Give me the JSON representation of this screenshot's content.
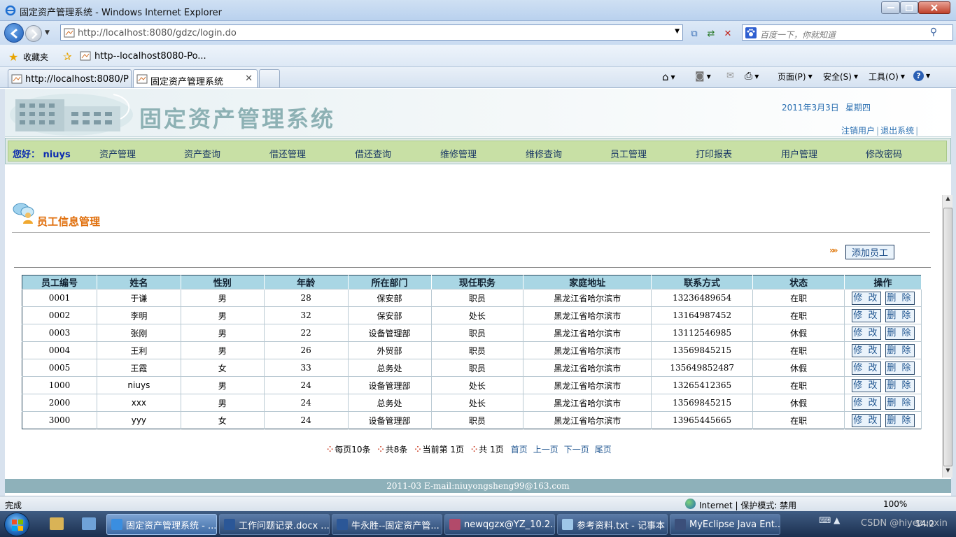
{
  "window": {
    "title": "固定资产管理系统 - Windows Internet Explorer"
  },
  "address": {
    "url": "http://localhost:8080/gdzc/login.do",
    "search_placeholder": "百度一下，你就知道"
  },
  "favorites": {
    "label": "收藏夹",
    "link": "http--localhost8080-Po..."
  },
  "tabs": [
    {
      "label": "http://localhost:8080/Po..."
    },
    {
      "label": "固定资产管理系统"
    }
  ],
  "commands": {
    "page": "页面(P)",
    "safety": "安全(S)",
    "tools": "工具(O)"
  },
  "app": {
    "title": "固定资产管理系统",
    "date": "2011年3月3日",
    "weekday": "星期四",
    "logout_user": "注销用户",
    "exit_system": "退出系统",
    "greeting": "您好：  niuys",
    "menu": [
      "资产管理",
      "资产查询",
      "借还管理",
      "借还查询",
      "维修管理",
      "维修查询",
      "员工管理",
      "打印报表",
      "用户管理",
      "修改密码"
    ],
    "section_title": "员工信息管理",
    "add_button": "添加员工",
    "footer": "2011-03 E-mail:niuyongsheng99@163.com"
  },
  "table": {
    "headers": [
      "员工编号",
      "姓名",
      "性别",
      "年龄",
      "所在部门",
      "现任职务",
      "家庭地址",
      "联系方式",
      "状态",
      "操作"
    ],
    "edit_label": "修 改",
    "delete_label": "删 除",
    "rows": [
      [
        "0001",
        "于谦",
        "男",
        "28",
        "保安部",
        "职员",
        "黑龙江省哈尔滨市",
        "13236489654",
        "在职"
      ],
      [
        "0002",
        "李明",
        "男",
        "32",
        "保安部",
        "处长",
        "黑龙江省哈尔滨市",
        "13164987452",
        "在职"
      ],
      [
        "0003",
        "张刚",
        "男",
        "22",
        "设备管理部",
        "职员",
        "黑龙江省哈尔滨市",
        "13112546985",
        "休假"
      ],
      [
        "0004",
        "王利",
        "男",
        "26",
        "外贸部",
        "职员",
        "黑龙江省哈尔滨市",
        "13569845215",
        "在职"
      ],
      [
        "0005",
        "王霞",
        "女",
        "33",
        "总务处",
        "职员",
        "黑龙江省哈尔滨市",
        "135649852487",
        "休假"
      ],
      [
        "1000",
        "niuys",
        "男",
        "24",
        "设备管理部",
        "处长",
        "黑龙江省哈尔滨市",
        "13265412365",
        "在职"
      ],
      [
        "2000",
        "xxx",
        "男",
        "24",
        "总务处",
        "处长",
        "黑龙江省哈尔滨市",
        "13569845215",
        "休假"
      ],
      [
        "3000",
        "yyy",
        "女",
        "24",
        "设备管理部",
        "职员",
        "黑龙江省哈尔滨市",
        "13965445665",
        "在职"
      ]
    ]
  },
  "pager": {
    "per_page": "每页10条",
    "total": "共8条",
    "current": "当前第  1页",
    "pages": "共  1页",
    "first": "首页",
    "prev": "上一页",
    "next": "下一页",
    "last": "尾页"
  },
  "status": {
    "done": "完成",
    "zone": "Internet | 保护模式: 禁用",
    "zoom": "100%"
  },
  "taskbar": {
    "tasks": [
      "固定资产管理系统 - ...",
      "工作问题记录.docx ...",
      "牛永胜--固定资产管...",
      "newqgzx@YZ_10.2....",
      "参考资料.txt - 记事本",
      "MyEclipse Java Ent..."
    ],
    "clock": "14:2",
    "watermark": "CSDN @hiyezuoxin"
  },
  "colors": {
    "menu_bg": "#c8e0a5",
    "header_cell": "#a9d6e4",
    "section_title": "#e06f0c",
    "link": "#1f5590",
    "footer": "#8eb1ba"
  }
}
